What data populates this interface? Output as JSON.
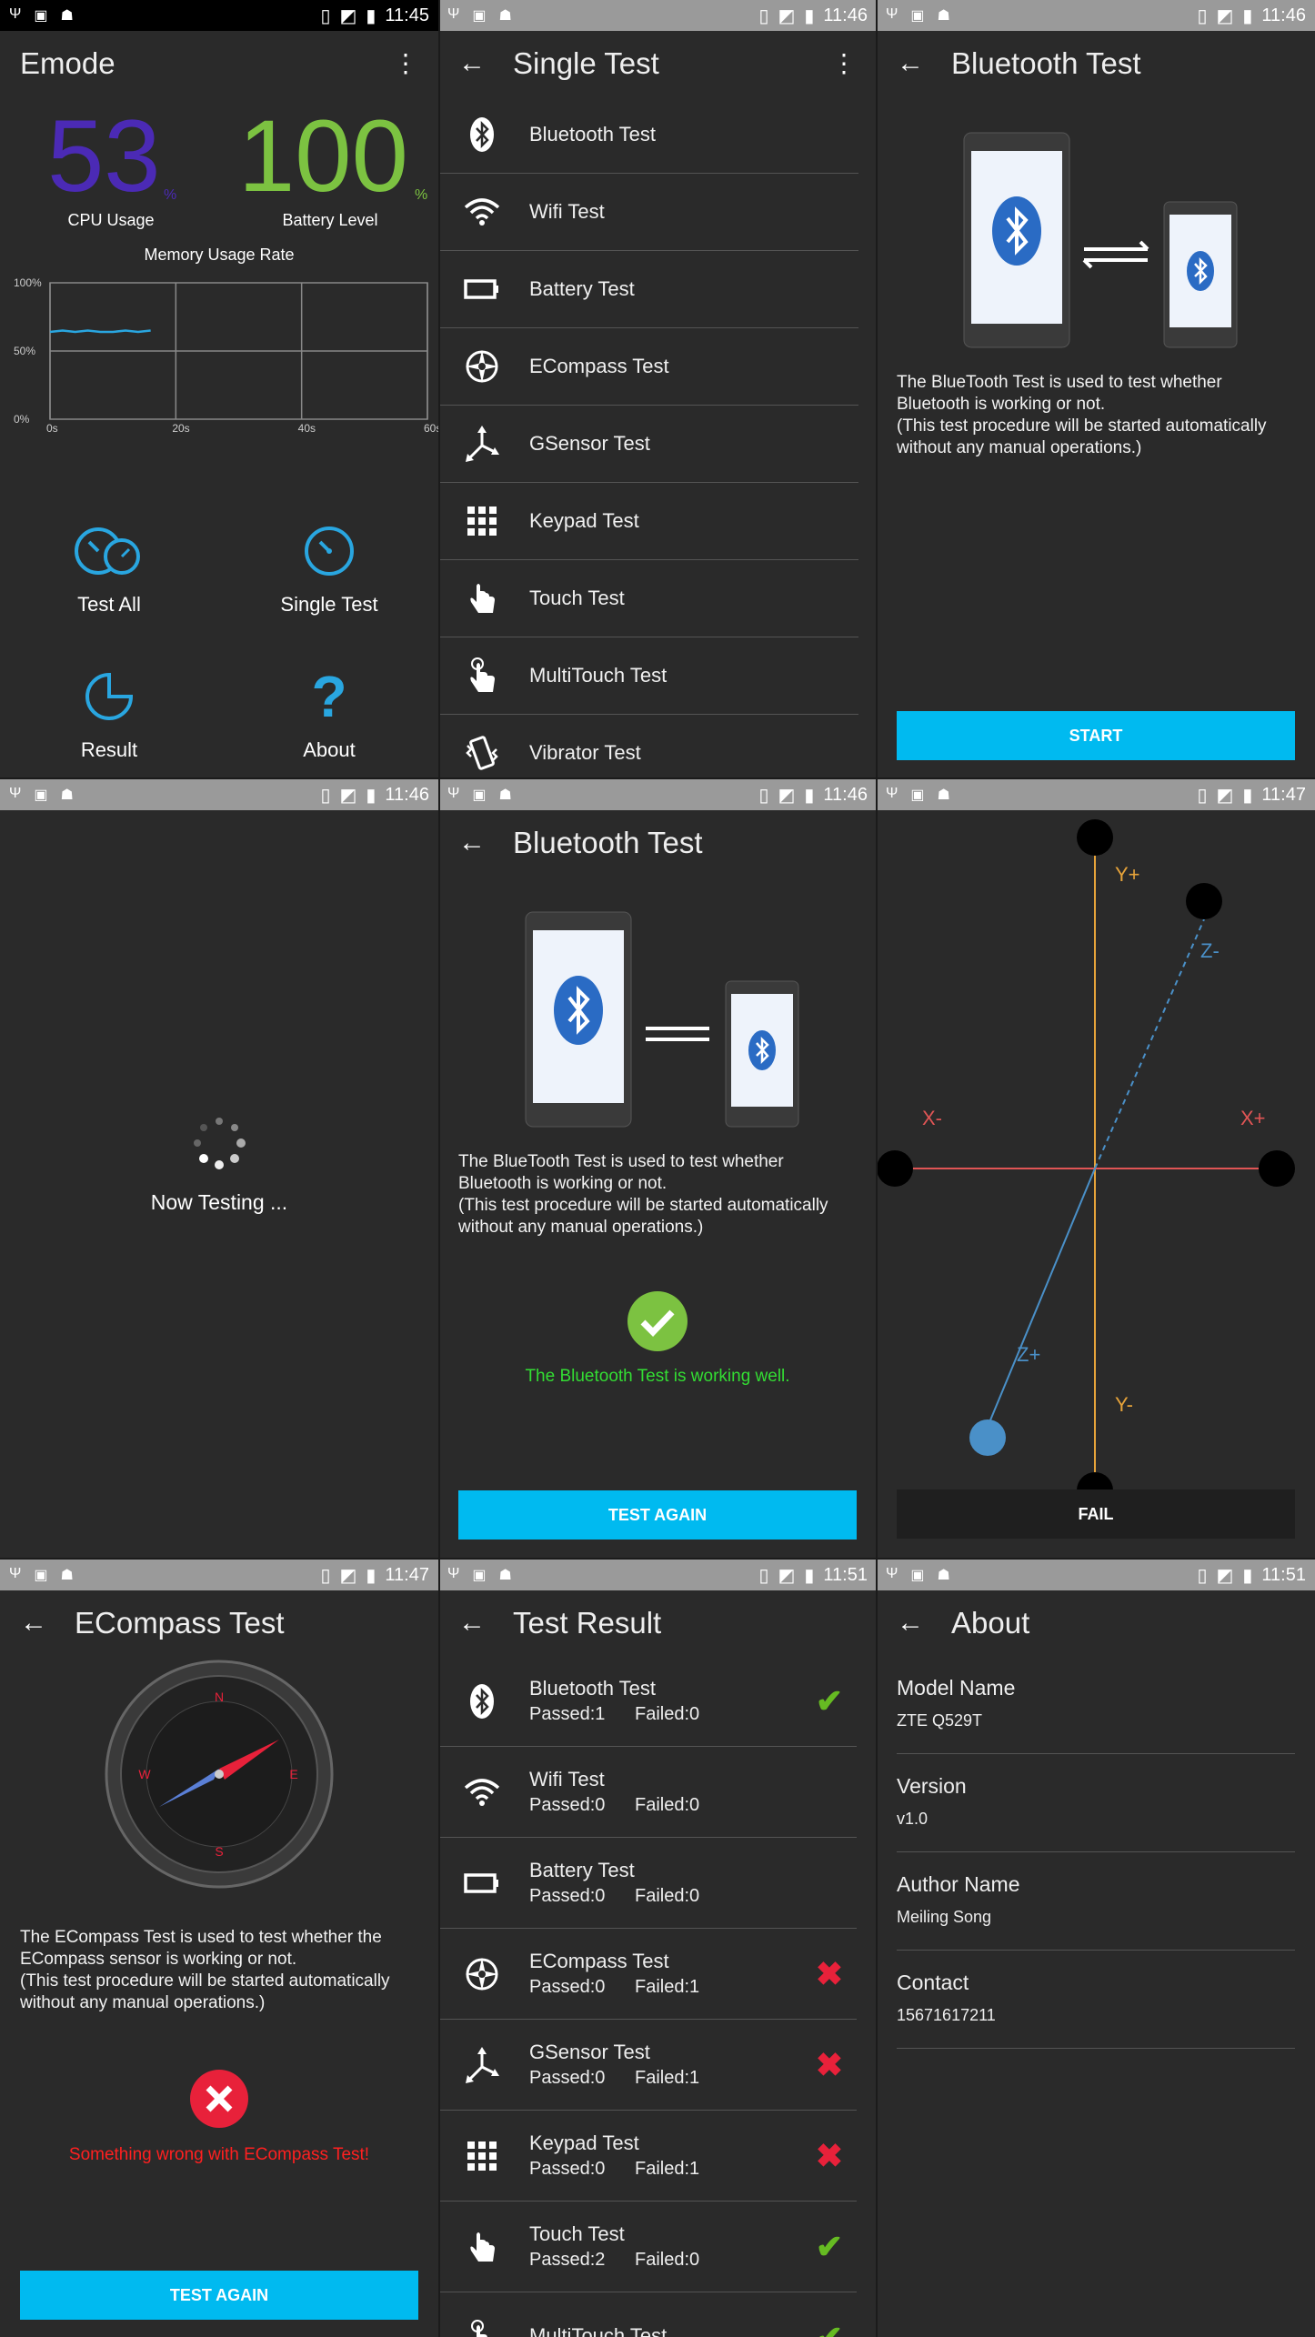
{
  "status": {
    "p1": "11:45",
    "p2": "11:46",
    "p3": "11:46",
    "p4": "11:46",
    "p5": "11:46",
    "p6": "11:47",
    "p7": "11:47",
    "p8": "11:51",
    "p9": "11:51"
  },
  "emode": {
    "title": "Emode",
    "cpu_value": "53",
    "cpu_unit": "%",
    "cpu_label": "CPU Usage",
    "battery_value": "100",
    "battery_unit": "%",
    "battery_label": "Battery Level",
    "memory_title": "Memory Usage Rate",
    "chart_data": {
      "type": "line",
      "title": "Memory Usage Rate",
      "x_ticks": [
        "0s",
        "20s",
        "40s",
        "60s"
      ],
      "y_ticks": [
        "100%",
        "50%",
        "0%"
      ],
      "xlim": [
        0,
        60
      ],
      "ylim": [
        0,
        100
      ],
      "grid": true,
      "series": [
        {
          "x": [
            0,
            2,
            4,
            6,
            8,
            10,
            12,
            14,
            16
          ],
          "y": [
            64,
            65,
            64,
            65,
            64,
            64,
            65,
            64,
            65
          ],
          "color": "#29a6e0"
        }
      ]
    },
    "tiles": [
      {
        "label": "Test All",
        "icon": "dual-gauge-icon"
      },
      {
        "label": "Single Test",
        "icon": "gauge-icon"
      },
      {
        "label": "Result",
        "icon": "pie-icon"
      },
      {
        "label": "About",
        "icon": "question-icon"
      }
    ],
    "accent": "#29a6e0"
  },
  "single": {
    "title": "Single Test",
    "items": [
      {
        "label": "Bluetooth Test",
        "icon": "bluetooth-icon"
      },
      {
        "label": "Wifi Test",
        "icon": "wifi-icon"
      },
      {
        "label": "Battery Test",
        "icon": "battery-icon"
      },
      {
        "label": "ECompass Test",
        "icon": "compass-icon"
      },
      {
        "label": "GSensor Test",
        "icon": "gsensor-icon"
      },
      {
        "label": "Keypad Test",
        "icon": "keypad-icon"
      },
      {
        "label": "Touch Test",
        "icon": "touch-icon"
      },
      {
        "label": "MultiTouch Test",
        "icon": "multitouch-icon"
      },
      {
        "label": "Vibrator Test",
        "icon": "vibrator-icon"
      }
    ]
  },
  "bt": {
    "title": "Bluetooth Test",
    "description": "The BlueTooth Test is used to test whether Bluetooth is working or not.\n(This test procedure will be started automatically without any manual operations.)",
    "start_label": "START",
    "result_message": "The Bluetooth Test is working well.",
    "again_label": "TEST AGAIN"
  },
  "testing": {
    "label": "Now Testing ..."
  },
  "gsensor": {
    "labels": {
      "yplus": "Y+",
      "yminus": "Y-",
      "xplus": "X+",
      "xminus": "X-",
      "zplus": "Z+",
      "zminus": "Z-"
    },
    "fail_label": "FAIL"
  },
  "ecompass": {
    "title": "ECompass Test",
    "description": "The ECompass Test is used to test whether the ECompass sensor is working or not.\n(This test procedure will be started automatically without any manual operations.)",
    "result_message": "Something wrong with ECompass Test!",
    "again_label": "TEST AGAIN",
    "dial": {
      "n": "N",
      "s": "S",
      "e": "E",
      "w": "W"
    }
  },
  "results": {
    "title": "Test Result",
    "passed_prefix": "Passed:",
    "failed_prefix": "Failed:",
    "rows": [
      {
        "name": "Bluetooth Test",
        "passed": "1",
        "failed": "0",
        "status": "pass",
        "icon": "bluetooth-icon"
      },
      {
        "name": "Wifi Test",
        "passed": "0",
        "failed": "0",
        "status": "none",
        "icon": "wifi-icon"
      },
      {
        "name": "Battery Test",
        "passed": "0",
        "failed": "0",
        "status": "none",
        "icon": "battery-icon"
      },
      {
        "name": "ECompass Test",
        "passed": "0",
        "failed": "1",
        "status": "fail",
        "icon": "compass-icon"
      },
      {
        "name": "GSensor Test",
        "passed": "0",
        "failed": "1",
        "status": "fail",
        "icon": "gsensor-icon"
      },
      {
        "name": "Keypad Test",
        "passed": "0",
        "failed": "1",
        "status": "fail",
        "icon": "keypad-icon"
      },
      {
        "name": "Touch Test",
        "passed": "2",
        "failed": "0",
        "status": "pass",
        "icon": "touch-icon"
      },
      {
        "name": "MultiTouch Test",
        "passed": "",
        "failed": "",
        "status": "pass",
        "icon": "multitouch-icon"
      }
    ]
  },
  "about": {
    "title": "About",
    "rows": [
      {
        "key": "Model Name",
        "value": "ZTE Q529T"
      },
      {
        "key": "Version",
        "value": "v1.0"
      },
      {
        "key": "Author Name",
        "value": "Meiling Song"
      },
      {
        "key": "Contact",
        "value": "15671617211"
      }
    ]
  },
  "colors": {
    "blue_button": "#00baf0",
    "pass_green": "#66bb22",
    "fail_red": "#e8213a",
    "ok_text": "#33dd33",
    "err_text": "#ff2020",
    "cpu_purple": "#4b2ab5",
    "battery_green": "#7cc241",
    "axis_orange": "#e6a33a",
    "axis_red": "#e05555",
    "axis_blue": "#4a90c8"
  }
}
